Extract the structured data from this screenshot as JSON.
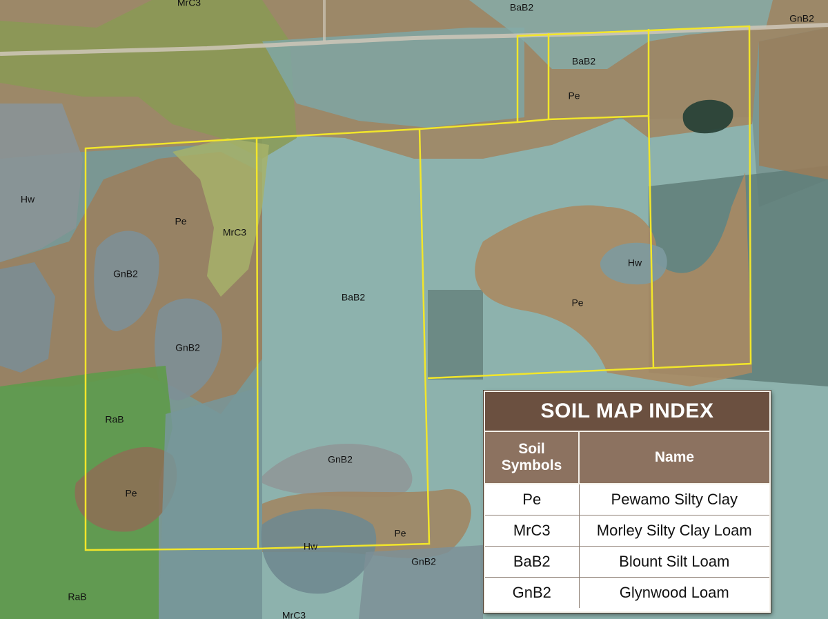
{
  "map": {
    "parcel_labels": [
      {
        "text": "MrC3"
      },
      {
        "text": "BaB2"
      },
      {
        "text": "GnB2"
      },
      {
        "text": "BaB2"
      },
      {
        "text": "Pe"
      },
      {
        "text": "Hw"
      },
      {
        "text": "Pe"
      },
      {
        "text": "MrC3"
      },
      {
        "text": "GnB2"
      },
      {
        "text": "BaB2"
      },
      {
        "text": "Hw"
      },
      {
        "text": "Pe"
      },
      {
        "text": "GnB2"
      },
      {
        "text": "RaB"
      },
      {
        "text": "GnB2"
      },
      {
        "text": "Pe"
      },
      {
        "text": "Pe"
      },
      {
        "text": "Hw"
      },
      {
        "text": "GnB2"
      },
      {
        "text": "RaB"
      },
      {
        "text": "MrC3"
      }
    ],
    "colors": {
      "boundary": "#f2e62a",
      "soil_Pe": "#a08664",
      "soil_MrC3": "#a6b26a",
      "soil_BaB2": "#8fb5b0",
      "soil_GnB2": "#7d8f96",
      "soil_RaB": "#5e9a4a",
      "soil_Hw": "#7a9098"
    }
  },
  "legend": {
    "title": "SOIL MAP INDEX",
    "col_symbol_line1": "Soil",
    "col_symbol_line2": "Symbols",
    "col_name": "Name",
    "rows": [
      {
        "symbol": "Pe",
        "name": "Pewamo Silty Clay"
      },
      {
        "symbol": "MrC3",
        "name": "Morley Silty Clay Loam"
      },
      {
        "symbol": "BaB2",
        "name": "Blount Silt Loam"
      },
      {
        "symbol": "GnB2",
        "name": "Glynwood Loam"
      }
    ]
  }
}
